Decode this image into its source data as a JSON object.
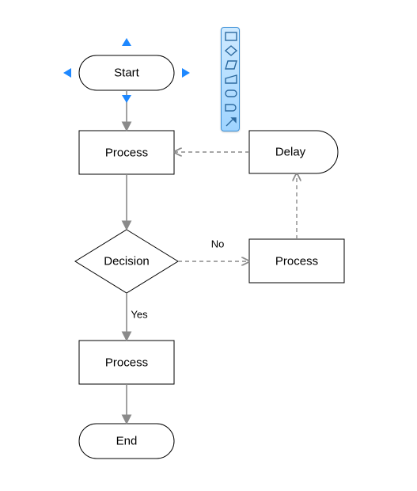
{
  "nodes": {
    "start": {
      "label": "Start"
    },
    "process1": {
      "label": "Process"
    },
    "decision": {
      "label": "Decision"
    },
    "process2": {
      "label": "Process"
    },
    "delay": {
      "label": "Delay"
    },
    "process3": {
      "label": "Process"
    },
    "end": {
      "label": "End"
    }
  },
  "edges": {
    "decision_no": {
      "label": "No"
    },
    "decision_yes": {
      "label": "Yes"
    }
  },
  "palette": {
    "items": [
      {
        "name": "rect-shape-icon"
      },
      {
        "name": "diamond-shape-icon"
      },
      {
        "name": "parallelogram-shape-icon"
      },
      {
        "name": "manual-input-shape-icon"
      },
      {
        "name": "terminator-shape-icon"
      },
      {
        "name": "delay-shape-icon"
      },
      {
        "name": "connector-arrow-icon"
      }
    ]
  }
}
